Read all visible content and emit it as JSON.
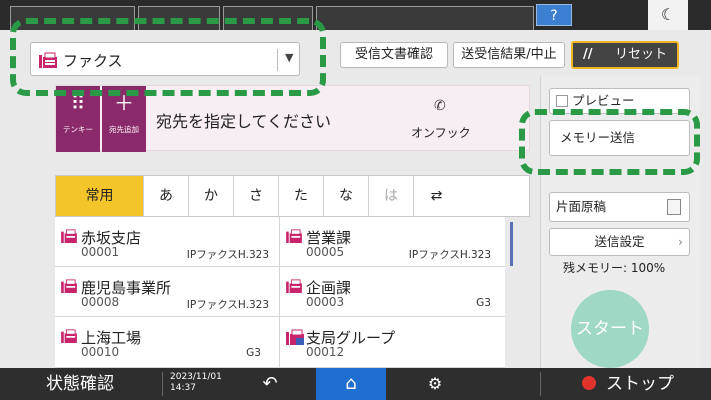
{
  "top_bar": {
    "help_label": "?",
    "theme_label": "☾"
  },
  "mode_selector": {
    "value": "ファクス",
    "caret": "▼"
  },
  "header_buttons": {
    "received_docs": "受信文書確認",
    "tx_results": "送受信結果/中止",
    "reset": "リセット"
  },
  "destination": {
    "keypad_label": "テンキー",
    "add_dest_label": "宛先追加",
    "prompt": "宛先を指定してください",
    "onhook_label": "オンフック"
  },
  "tabs": [
    {
      "label": "常用"
    },
    {
      "label": "あ"
    },
    {
      "label": "か"
    },
    {
      "label": "さ"
    },
    {
      "label": "た"
    },
    {
      "label": "な"
    },
    {
      "label": "は"
    },
    {
      "label": "⇄"
    }
  ],
  "address_entries": [
    {
      "name": "赤坂支店",
      "number": "00001",
      "kind": "IPファクスH.323"
    },
    {
      "name": "営業課",
      "number": "00005",
      "kind": "IPファクスH.323"
    },
    {
      "name": "鹿児島事業所",
      "number": "00008",
      "kind": "IPファクスH.323"
    },
    {
      "name": "企画課",
      "number": "00003",
      "kind": "G3"
    },
    {
      "name": "上海工場",
      "number": "00010",
      "kind": "G3"
    },
    {
      "name": "支局グループ",
      "number": "00012",
      "kind": ""
    }
  ],
  "right_panel": {
    "preview_label": "プレビュー",
    "memory_tx": "メモリー送信",
    "single_side": "片面原稿",
    "tx_settings": "送信設定",
    "remaining_memory": "残メモリー:  100%",
    "start": "スタート"
  },
  "bottom_bar": {
    "status": "状態確認",
    "date": "2023/11/01",
    "time": "14:37",
    "stop": "ストップ"
  },
  "colors": {
    "accent_purple": "#8b2a6b",
    "tab_active": "#f3c52a",
    "reset_border": "#f0b523",
    "home_blue": "#1f6fd1",
    "callout_green": "#2a9a46",
    "start_green": "#9fd8c4"
  },
  "icons": {
    "fax": "fax-icon",
    "keypad": "keypad-icon",
    "add": "plus-icon",
    "phone": "phone-icon",
    "reset": "reset-icon",
    "back": "back-arrow-icon",
    "home": "home-icon",
    "settings": "gear-icon",
    "stop": "stop-icon",
    "group": "group-icon"
  }
}
